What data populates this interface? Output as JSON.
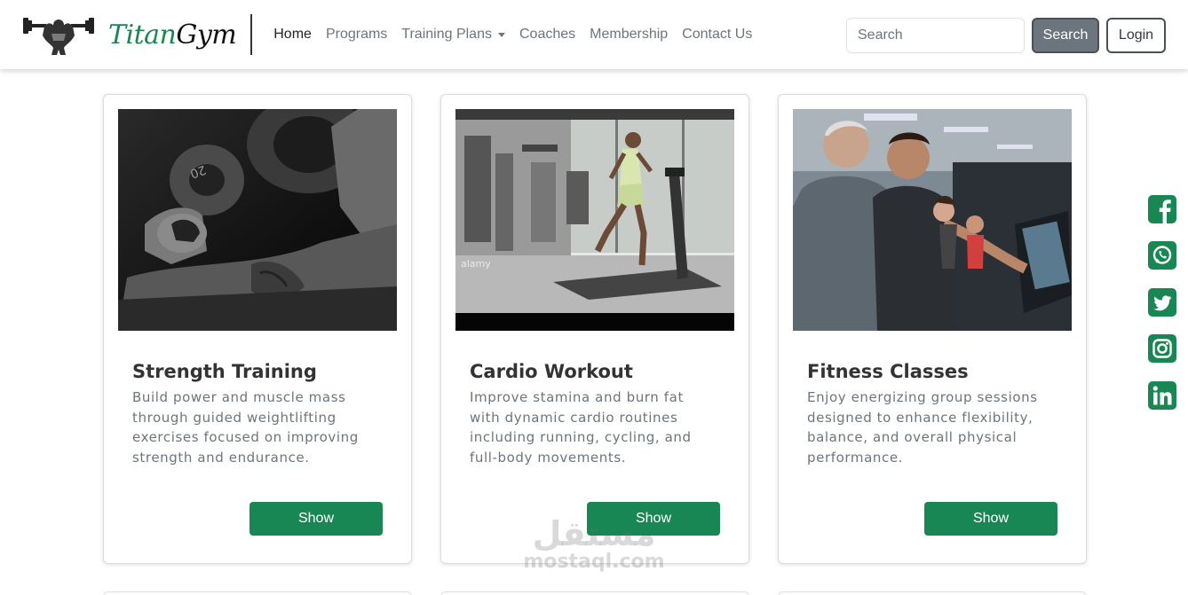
{
  "brand": {
    "name_part1": "Titan",
    "name_part2": "Gym"
  },
  "nav": {
    "links": [
      {
        "label": "Home"
      },
      {
        "label": "Programs"
      },
      {
        "label": "Training Plans"
      },
      {
        "label": "Coaches"
      },
      {
        "label": "Membership"
      },
      {
        "label": "Contact Us"
      }
    ]
  },
  "search": {
    "placeholder": "Search",
    "button_label": "Search"
  },
  "login": {
    "label": "Login"
  },
  "cards": [
    {
      "title": "Strength Training",
      "text": "Build power and muscle mass through guided weightlifting exercises focused on improving strength and endurance.",
      "button": "Show",
      "image_plate": "20"
    },
    {
      "title": "Cardio Workout",
      "text": "Improve stamina and burn fat with dynamic cardio routines including running, cycling, and full-body movements.",
      "button": "Show",
      "image_watermark": "alamy"
    },
    {
      "title": "Fitness Classes",
      "text": "Enjoy energizing group sessions designed to enhance flexibility, balance, and overall physical performance.",
      "button": "Show"
    }
  ],
  "social": [
    {
      "icon": "facebook-icon"
    },
    {
      "icon": "whatsapp-icon"
    },
    {
      "icon": "twitter-icon"
    },
    {
      "icon": "instagram-icon"
    },
    {
      "icon": "linkedin-icon"
    }
  ],
  "watermark": {
    "arabic": "مستقل",
    "latin": "mostaql.com"
  },
  "colors": {
    "accent": "#198754",
    "secondary": "#6c757d"
  }
}
